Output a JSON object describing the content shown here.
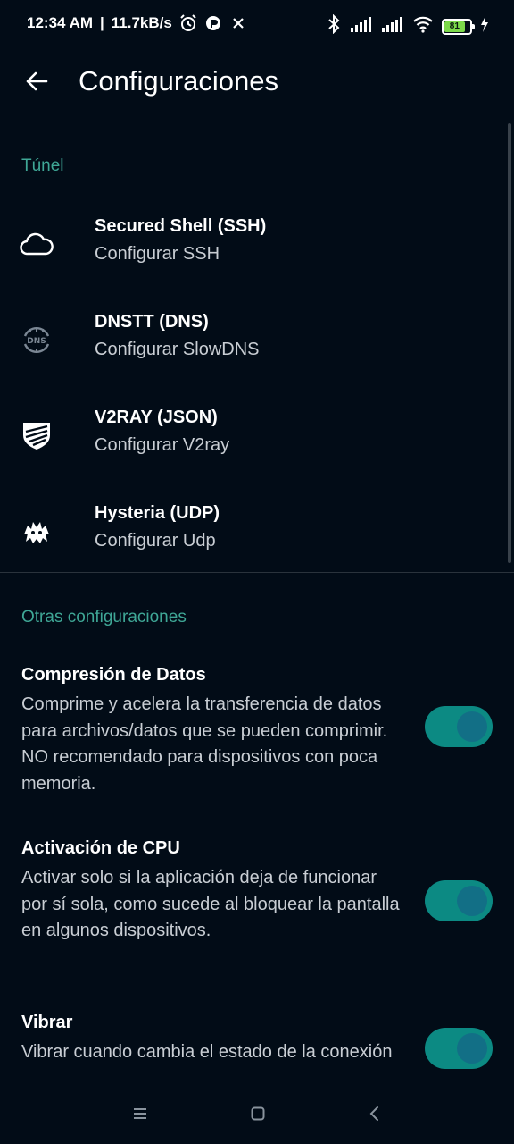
{
  "status_bar": {
    "time": "12:34 AM",
    "separator": "|",
    "speed": "11.7kB/s",
    "battery_level": "81"
  },
  "app_bar": {
    "title": "Configuraciones"
  },
  "tunnel_section": {
    "header": "Túnel",
    "items": [
      {
        "title": "Secured Shell (SSH)",
        "subtitle": "Configurar SSH",
        "icon": "cloud-icon"
      },
      {
        "title": "DNSTT (DNS)",
        "subtitle": "Configurar SlowDNS",
        "icon": "dns-globe-icon"
      },
      {
        "title": "V2RAY (JSON)",
        "subtitle": "Configurar V2ray",
        "icon": "v2ray-icon"
      },
      {
        "title": "Hysteria (UDP)",
        "subtitle": "Configurar Udp",
        "icon": "hysteria-icon"
      }
    ]
  },
  "other_section": {
    "header": "Otras configuraciones",
    "items": [
      {
        "title": "Compresión de Datos",
        "desc": "Comprime y acelera la transferencia de datos para archivos/datos que se pueden comprimir. NO recomendado para dispositivos con poca memoria.",
        "enabled": true
      },
      {
        "title": "Activación de CPU",
        "desc": "Activar solo si la aplicación deja de funcionar por sí sola, como sucede al bloquear la pantalla en algunos dispositivos.",
        "enabled": true
      },
      {
        "title": "Vibrar",
        "desc": "Vibrar cuando cambia el estado de la conexión",
        "enabled": true
      }
    ]
  },
  "colors": {
    "background": "#020c17",
    "accent": "#3fa796",
    "toggle_track": "#0c8a83",
    "toggle_thumb": "#126f86"
  }
}
